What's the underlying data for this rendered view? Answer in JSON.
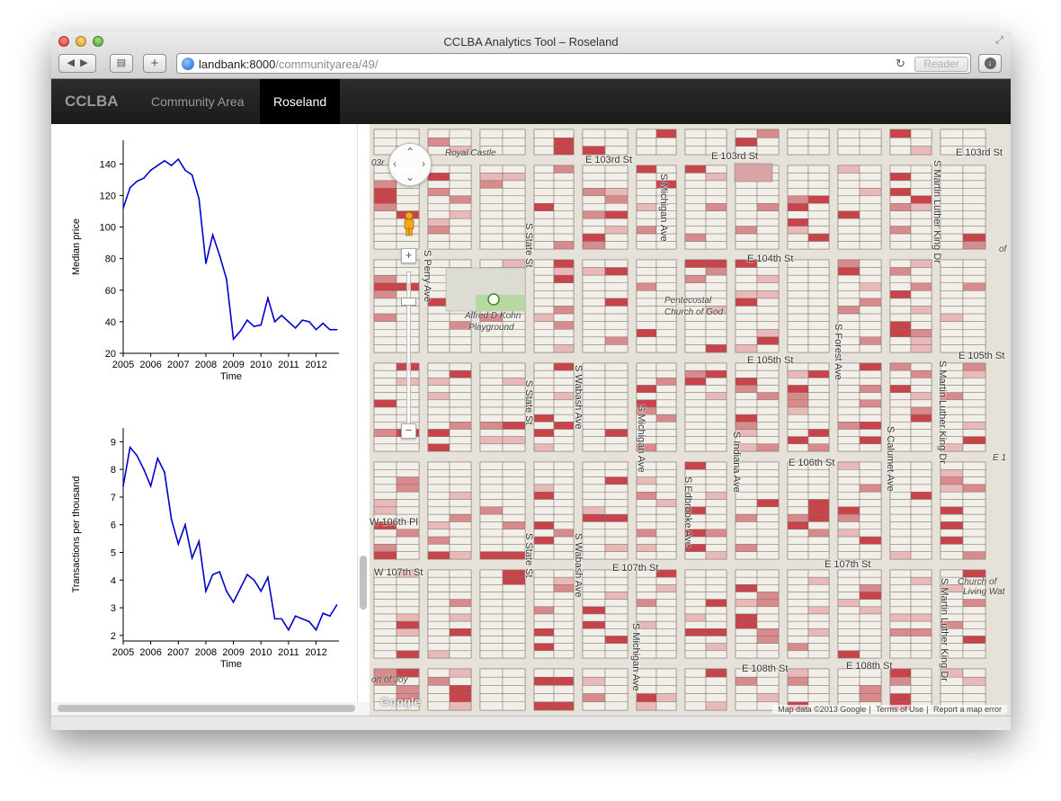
{
  "window": {
    "title": "CCLBA Analytics Tool – Roseland"
  },
  "toolbar": {
    "url_host": "landbank:8000",
    "url_path": "/communityarea/49/",
    "reader_label": "Reader"
  },
  "navbar": {
    "brand": "CCLBA",
    "links": [
      "Community Area",
      "Roseland"
    ],
    "active_index": 1
  },
  "charts": {
    "chart_data": [
      {
        "type": "line",
        "xlabel": "Time",
        "ylabel": "Median price",
        "xlim": [
          2005.0,
          2012.83
        ],
        "ylim": [
          20,
          155
        ],
        "x_ticks": [
          "2005",
          "2006",
          "2007",
          "2008",
          "2009",
          "2010",
          "2011",
          "2012"
        ],
        "y_ticks": [
          "20",
          "40",
          "60",
          "80",
          "100",
          "120",
          "140"
        ],
        "color": "#0000cc",
        "x": [
          2005.0,
          2005.25,
          2005.5,
          2005.75,
          2006.0,
          2006.25,
          2006.5,
          2006.75,
          2007.0,
          2007.25,
          2007.5,
          2007.75,
          2008.0,
          2008.25,
          2008.5,
          2008.75,
          2009.0,
          2009.25,
          2009.5,
          2009.75,
          2010.0,
          2010.25,
          2010.5,
          2010.75,
          2011.0,
          2011.25,
          2011.5,
          2011.75,
          2012.0,
          2012.25,
          2012.5,
          2012.75
        ],
        "values": [
          112,
          125,
          129,
          131,
          136,
          139,
          142,
          139,
          143,
          136,
          133,
          118,
          77,
          95,
          82,
          67,
          29,
          34,
          41,
          37,
          38,
          55,
          40,
          44,
          40,
          36,
          41,
          40,
          35,
          39,
          35,
          35
        ]
      },
      {
        "type": "line",
        "xlabel": "Time",
        "ylabel": "Transactions per thousand",
        "xlim": [
          2005.0,
          2012.83
        ],
        "ylim": [
          1.8,
          9.5
        ],
        "x_ticks": [
          "2005",
          "2006",
          "2007",
          "2008",
          "2009",
          "2010",
          "2011",
          "2012"
        ],
        "y_ticks": [
          "2",
          "3",
          "4",
          "5",
          "6",
          "7",
          "8",
          "9"
        ],
        "color": "#0000cc",
        "x": [
          2005.0,
          2005.25,
          2005.5,
          2005.75,
          2006.0,
          2006.25,
          2006.5,
          2006.75,
          2007.0,
          2007.25,
          2007.5,
          2007.75,
          2008.0,
          2008.25,
          2008.5,
          2008.75,
          2009.0,
          2009.25,
          2009.5,
          2009.75,
          2010.0,
          2010.25,
          2010.5,
          2010.75,
          2011.0,
          2011.25,
          2011.5,
          2011.75,
          2012.0,
          2012.25,
          2012.5,
          2012.75
        ],
        "values": [
          7.4,
          8.8,
          8.5,
          8.0,
          7.4,
          8.4,
          7.9,
          6.2,
          5.3,
          6.0,
          4.8,
          5.4,
          3.6,
          4.2,
          4.3,
          3.6,
          3.2,
          3.7,
          4.2,
          4.0,
          3.6,
          4.1,
          2.6,
          2.6,
          2.2,
          2.7,
          2.6,
          2.5,
          2.2,
          2.8,
          2.7,
          3.1
        ]
      }
    ]
  },
  "map": {
    "streets_h": [
      {
        "label": "E 103rd St",
        "x": 240,
        "y": 34
      },
      {
        "label": "E 103rd St",
        "x": 380,
        "y": 30
      },
      {
        "label": "E 103rd St",
        "x": 652,
        "y": 26
      },
      {
        "label": "E 104th St",
        "x": 420,
        "y": 144
      },
      {
        "label": "E 105th St",
        "x": 420,
        "y": 257
      },
      {
        "label": "E 105th St",
        "x": 655,
        "y": 252
      },
      {
        "label": "E 106th St",
        "x": 466,
        "y": 371
      },
      {
        "label": "W 106th Pl",
        "x": 0,
        "y": 437
      },
      {
        "label": "W 107th St",
        "x": 5,
        "y": 493
      },
      {
        "label": "E 107th St",
        "x": 270,
        "y": 488
      },
      {
        "label": "E 107th St",
        "x": 506,
        "y": 484
      },
      {
        "label": "E 108th St",
        "x": 414,
        "y": 600
      },
      {
        "label": "E 108th St",
        "x": 530,
        "y": 597
      }
    ],
    "streets_v": [
      {
        "label": "S Perry Ave",
        "x": 70,
        "y": 140
      },
      {
        "label": "S State St",
        "x": 183,
        "y": 110
      },
      {
        "label": "S State St",
        "x": 183,
        "y": 285
      },
      {
        "label": "S State St",
        "x": 183,
        "y": 455
      },
      {
        "label": "S Wabash Ave",
        "x": 238,
        "y": 268
      },
      {
        "label": "S Wabash Ave",
        "x": 238,
        "y": 455
      },
      {
        "label": "S Michigan Ave",
        "x": 333,
        "y": 55
      },
      {
        "label": "S Michigan Ave",
        "x": 308,
        "y": 312
      },
      {
        "label": "S Michigan Ave",
        "x": 302,
        "y": 555
      },
      {
        "label": "S Edbrooke Ave",
        "x": 360,
        "y": 392
      },
      {
        "label": "S Indiana Ave",
        "x": 414,
        "y": 342
      },
      {
        "label": "S Forest Ave",
        "x": 527,
        "y": 222
      },
      {
        "label": "S Calumet Ave",
        "x": 585,
        "y": 336
      },
      {
        "label": "S Martin Luther King Dr",
        "x": 637,
        "y": 40
      },
      {
        "label": "S Martin Luther King Dr",
        "x": 643,
        "y": 263
      },
      {
        "label": "S Martin Luther King Dr",
        "x": 645,
        "y": 505
      }
    ],
    "pois": [
      {
        "label": "Royal Castle",
        "x": 84,
        "y": 27
      },
      {
        "label": "Pentecostal",
        "x": 328,
        "y": 191
      },
      {
        "label": "Church of God",
        "x": 328,
        "y": 204
      },
      {
        "label": "Alfred D Kohn",
        "x": 106,
        "y": 208
      },
      {
        "label": "Playground",
        "x": 110,
        "y": 221
      },
      {
        "label": "Church of",
        "x": 654,
        "y": 504
      },
      {
        "label": "Living Wat",
        "x": 660,
        "y": 515
      },
      {
        "label": "on of Joy",
        "x": 2,
        "y": 613
      },
      {
        "label": "E 1",
        "x": 693,
        "y": 366
      },
      {
        "label": "of",
        "x": 700,
        "y": 134
      },
      {
        "label": "03r",
        "x": 2,
        "y": 38
      }
    ],
    "google_logo": "Google",
    "attribution": [
      "Map data ©2013 Google",
      "Terms of Use",
      "Report a map error"
    ]
  }
}
